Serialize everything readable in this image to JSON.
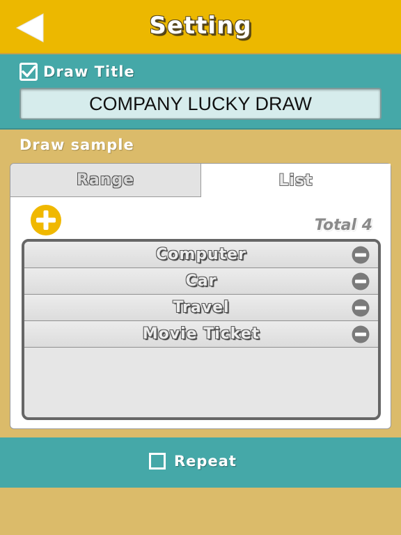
{
  "header": {
    "title": "Setting",
    "back_icon": "back-arrow-icon",
    "background": "#ecb800"
  },
  "title_section": {
    "checkbox_checked": true,
    "checkbox_label": "Draw Title",
    "input_value": "COMPANY LUCKY DRAW",
    "background": "#45a8a8"
  },
  "sample": {
    "label": "Draw sample",
    "tabs": [
      {
        "label": "Range",
        "active": false
      },
      {
        "label": "List",
        "active": true
      }
    ],
    "add_icon": "plus-circle-icon",
    "total_label": "Total 4",
    "items": [
      {
        "label": "Computer"
      },
      {
        "label": "Car"
      },
      {
        "label": "Travel"
      },
      {
        "label": "Movie Ticket"
      }
    ],
    "remove_icon": "minus-circle-icon"
  },
  "repeat": {
    "checkbox_checked": false,
    "label": "Repeat"
  },
  "colors": {
    "header": "#ecb800",
    "teal": "#45a8a8",
    "sand": "#dbbb6a",
    "accent_yellow": "#f0b800"
  }
}
